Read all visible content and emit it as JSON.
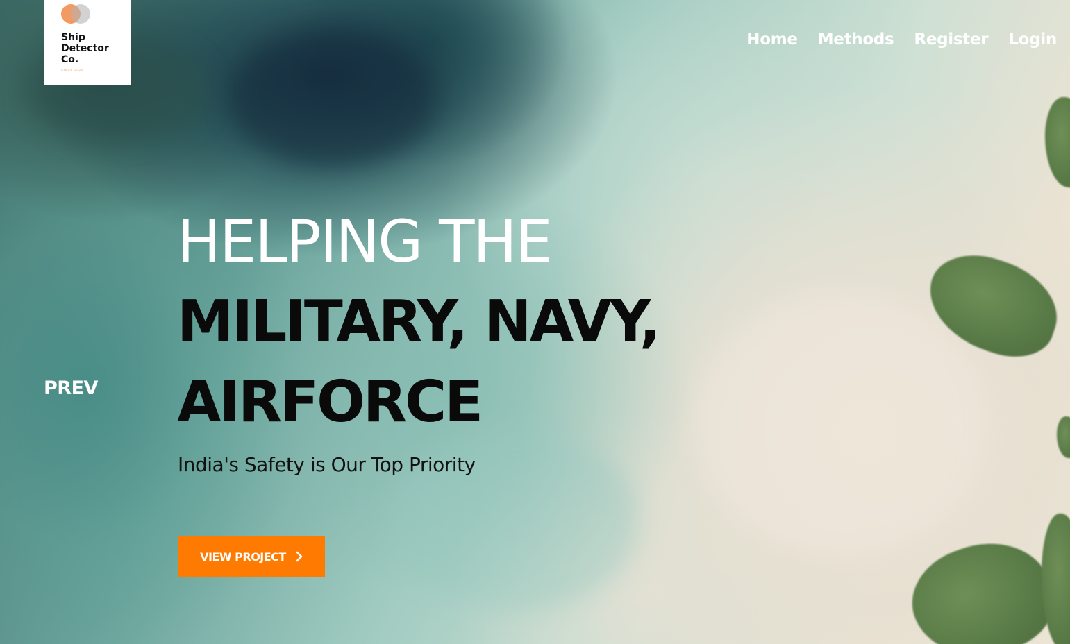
{
  "logo": {
    "name": "Ship\nDetector\nCo.",
    "since": "SINCE 2020",
    "colors": {
      "circle_primary": "#f39a62",
      "circle_secondary": "#b4b4b4"
    }
  },
  "nav": {
    "items": [
      {
        "label": "Home"
      },
      {
        "label": "Methods"
      },
      {
        "label": "Register"
      },
      {
        "label": "Login"
      }
    ]
  },
  "slider": {
    "prev_label": "PREV"
  },
  "hero": {
    "line1": "HELPING THE",
    "line2": "MILITARY, NAVY,",
    "line3": "AIRFORCE",
    "subtitle": "India's Safety is Our Top Priority",
    "cta_label": "VIEW PROJECT",
    "cta_icon": "chevron-right-icon",
    "colors": {
      "accent": "#ff7a00"
    }
  }
}
